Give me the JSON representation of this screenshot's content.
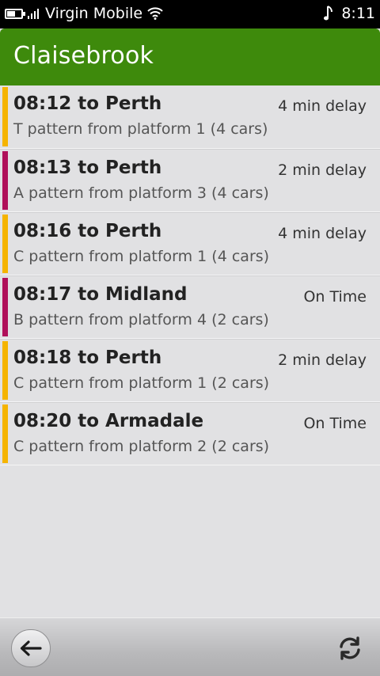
{
  "status_bar": {
    "carrier": "Virgin Mobile",
    "time": "8:11",
    "battery_level": 0.6,
    "icons": [
      "battery-icon",
      "signal-icon",
      "wifi-icon",
      "music-note-icon"
    ]
  },
  "header": {
    "title": "Claisebrook",
    "color": "#3e8a0c"
  },
  "trains": [
    {
      "title": "08:12 to Perth",
      "status": "4 min delay",
      "detail": "T pattern from platform 1 (4 cars)",
      "line_color": "#f5b400"
    },
    {
      "title": "08:13 to Perth",
      "status": "2 min delay",
      "detail": "A pattern from platform 3 (4 cars)",
      "line_color": "#b0105a"
    },
    {
      "title": "08:16 to Perth",
      "status": "4 min delay",
      "detail": "C pattern from platform 1 (4 cars)",
      "line_color": "#f5b400"
    },
    {
      "title": "08:17 to Midland",
      "status": "On Time",
      "detail": "B pattern from platform 4 (2 cars)",
      "line_color": "#b0105a"
    },
    {
      "title": "08:18 to Perth",
      "status": "2 min delay",
      "detail": "C pattern from platform 1 (2 cars)",
      "line_color": "#f5b400"
    },
    {
      "title": "08:20 to Armadale",
      "status": "On Time",
      "detail": "C pattern from platform 2 (2 cars)",
      "line_color": "#f5b400"
    }
  ],
  "toolbar": {
    "back_icon": "back-arrow-icon",
    "refresh_icon": "refresh-icon"
  }
}
